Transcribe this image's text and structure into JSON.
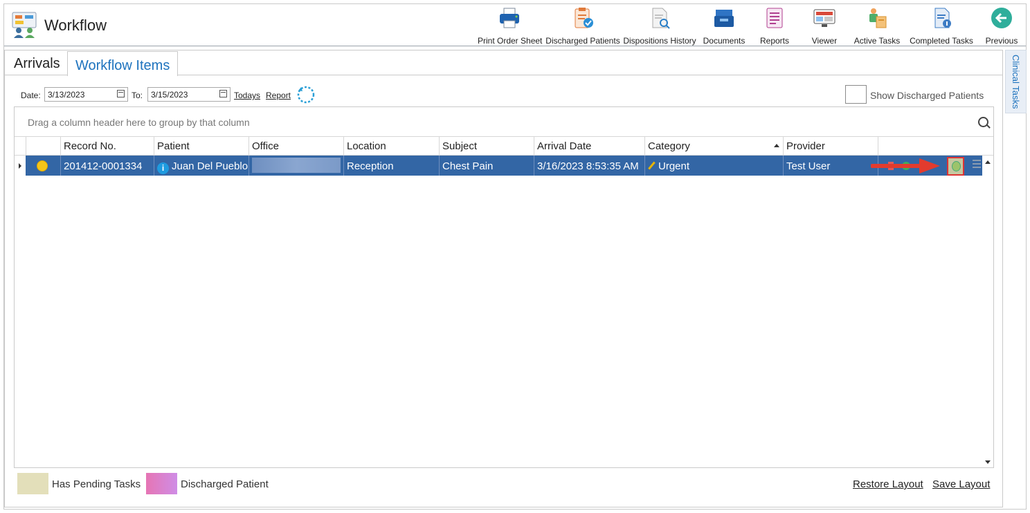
{
  "app": {
    "title": "Workflow"
  },
  "toolbar": {
    "print_order_sheet": "Print Order Sheet",
    "discharged_patients": "Discharged Patients",
    "dispositions_history": "Dispositions History",
    "documents": "Documents",
    "reports": "Reports",
    "viewer": "Viewer",
    "active_tasks": "Active Tasks",
    "completed_tasks": "Completed Tasks",
    "previous": "Previous"
  },
  "tabs": {
    "arrivals": "Arrivals",
    "workflow_items": "Workflow Items"
  },
  "side_panel": {
    "label": "Clinical Tasks"
  },
  "filters": {
    "date_label": "Date:",
    "date_from": "3/13/2023",
    "to_label": "To:",
    "date_to": "3/15/2023",
    "todays": "Todays",
    "report": "Report",
    "show_discharged_label": "Show Discharged Patients"
  },
  "grid": {
    "group_hint": "Drag a column header here to group by that column",
    "columns": [
      "Record No.",
      "Patient",
      "Office",
      "Location",
      "Subject",
      "Arrival Date",
      "Category",
      "Provider"
    ],
    "rows": [
      {
        "record_no": "201412-0001334",
        "patient": "Juan Del Pueblo",
        "office": "",
        "location": "Reception",
        "subject": "Chest Pain",
        "arrival_date": "3/16/2023 8:53:35 AM",
        "category": "Urgent",
        "provider": "Test User"
      }
    ]
  },
  "legend": {
    "pending": "Has Pending Tasks",
    "pending_color": "#e3dfba",
    "discharged": "Discharged Patient",
    "discharged_color": "#e675b4"
  },
  "footer": {
    "restore_layout": "Restore Layout",
    "save_layout": "Save Layout"
  },
  "colors": {
    "accent": "#1e73be",
    "selected_row": "#3366a5",
    "highlight_arrow": "#e23b2e"
  }
}
